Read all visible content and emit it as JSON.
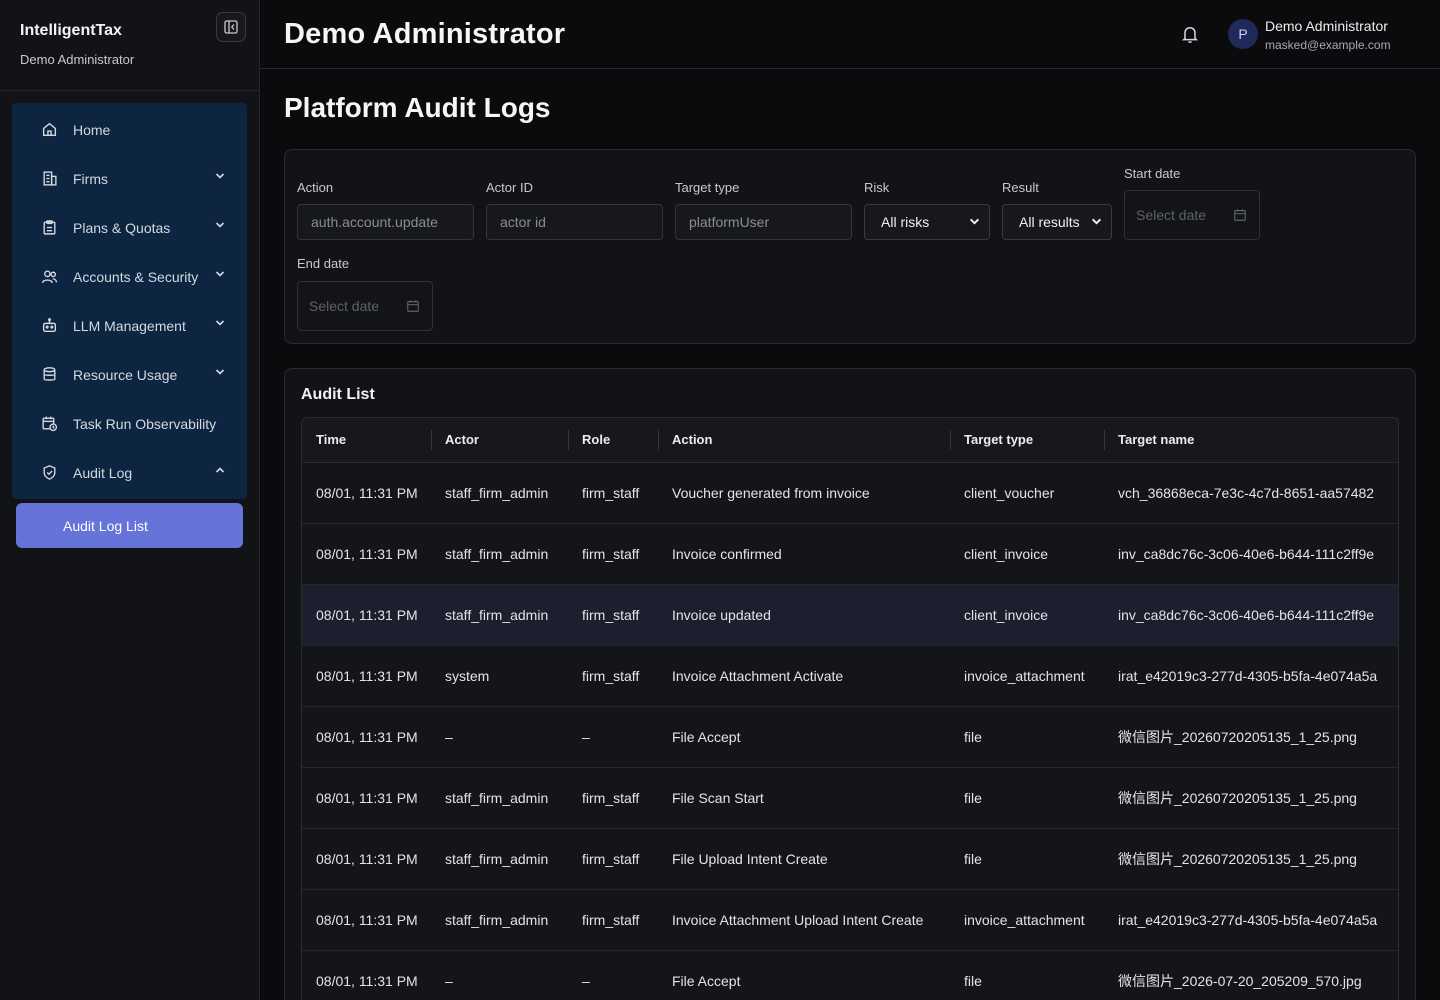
{
  "brand": {
    "name": "IntelligentTax",
    "subtitle": "Demo Administrator"
  },
  "sidebar": {
    "items": [
      {
        "label": "Home",
        "icon": "home-icon",
        "expandable": false
      },
      {
        "label": "Firms",
        "icon": "building-icon",
        "expandable": true
      },
      {
        "label": "Plans & Quotas",
        "icon": "clipboard-icon",
        "expandable": true
      },
      {
        "label": "Accounts & Security",
        "icon": "users-icon",
        "expandable": true
      },
      {
        "label": "LLM Management",
        "icon": "robot-icon",
        "expandable": true
      },
      {
        "label": "Resource Usage",
        "icon": "database-icon",
        "expandable": true
      },
      {
        "label": "Task Run Observability",
        "icon": "calendar-clock-icon",
        "expandable": false
      },
      {
        "label": "Audit Log",
        "icon": "shield-check-icon",
        "expandable": true,
        "expanded": true
      }
    ],
    "active_sub_item": "Audit Log List"
  },
  "header": {
    "title": "Demo Administrator",
    "user_initial": "P",
    "user_name": "Demo Administrator",
    "user_email": "masked@example.com"
  },
  "page": {
    "title": "Platform Audit Logs"
  },
  "filters": {
    "action": {
      "label": "Action",
      "placeholder": "auth.account.update"
    },
    "actor_id": {
      "label": "Actor ID",
      "placeholder": "actor id"
    },
    "target_type": {
      "label": "Target type",
      "placeholder": "platformUser"
    },
    "risk": {
      "label": "Risk",
      "value": "All risks"
    },
    "result": {
      "label": "Result",
      "value": "All results"
    },
    "start_date": {
      "label": "Start date",
      "placeholder": "Select date"
    },
    "end_date": {
      "label": "End date",
      "placeholder": "Select date"
    }
  },
  "audit_list": {
    "title": "Audit List",
    "columns": [
      "Time",
      "Actor",
      "Role",
      "Action",
      "Target type",
      "Target name"
    ],
    "rows": [
      [
        "08/01, 11:31 PM",
        "staff_firm_admin",
        "firm_staff",
        "Voucher generated from invoice",
        "client_voucher",
        "vch_36868eca-7e3c-4c7d-8651-aa57482"
      ],
      [
        "08/01, 11:31 PM",
        "staff_firm_admin",
        "firm_staff",
        "Invoice confirmed",
        "client_invoice",
        "inv_ca8dc76c-3c06-40e6-b644-111c2ff9e"
      ],
      [
        "08/01, 11:31 PM",
        "staff_firm_admin",
        "firm_staff",
        "Invoice updated",
        "client_invoice",
        "inv_ca8dc76c-3c06-40e6-b644-111c2ff9e"
      ],
      [
        "08/01, 11:31 PM",
        "system",
        "firm_staff",
        "Invoice Attachment Activate",
        "invoice_attachment",
        "irat_e42019c3-277d-4305-b5fa-4e074a5a"
      ],
      [
        "08/01, 11:31 PM",
        "–",
        "–",
        "File Accept",
        "file",
        "微信图片_20260720205135_1_25.png"
      ],
      [
        "08/01, 11:31 PM",
        "staff_firm_admin",
        "firm_staff",
        "File Scan Start",
        "file",
        "微信图片_20260720205135_1_25.png"
      ],
      [
        "08/01, 11:31 PM",
        "staff_firm_admin",
        "firm_staff",
        "File Upload Intent Create",
        "file",
        "微信图片_20260720205135_1_25.png"
      ],
      [
        "08/01, 11:31 PM",
        "staff_firm_admin",
        "firm_staff",
        "Invoice Attachment Upload Intent Create",
        "invoice_attachment",
        "irat_e42019c3-277d-4305-b5fa-4e074a5a"
      ],
      [
        "08/01, 11:31 PM",
        "–",
        "–",
        "File Accept",
        "file",
        "微信图片_2026-07-20_205209_570.jpg"
      ]
    ],
    "highlighted_row": 2
  },
  "colors": {
    "accent": "#6674d9",
    "nav_bg": "#0d2541",
    "background": "#0b0b0d"
  }
}
